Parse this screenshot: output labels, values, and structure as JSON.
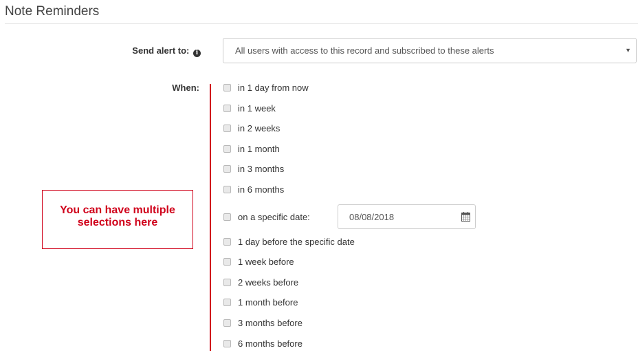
{
  "title": "Note Reminders",
  "send_alert": {
    "label": "Send alert to:",
    "info_icon": "info-circle-icon",
    "selected_value": "All users with access to this record and subscribed to these alerts"
  },
  "when": {
    "label": "When:",
    "options": [
      {
        "label": "in 1 day from now",
        "checked": false
      },
      {
        "label": "in 1 week",
        "checked": false
      },
      {
        "label": "in 2 weeks",
        "checked": false
      },
      {
        "label": "in 1 month",
        "checked": false
      },
      {
        "label": "in 3 months",
        "checked": false
      },
      {
        "label": "in 6 months",
        "checked": false
      },
      {
        "label": "on a specific date:",
        "checked": false
      },
      {
        "label": "1 day before the specific date",
        "checked": false
      },
      {
        "label": "1 week before",
        "checked": false
      },
      {
        "label": "2 weeks before",
        "checked": false
      },
      {
        "label": "1 month before",
        "checked": false
      },
      {
        "label": "3 months before",
        "checked": false
      },
      {
        "label": "6 months before",
        "checked": false
      }
    ],
    "specific_date_value": "08/08/2018"
  },
  "callout": {
    "line1": "You can have multiple",
    "line2": "selections here"
  },
  "colors": {
    "annotation_red": "#d0021b",
    "border": "#cccccc"
  }
}
